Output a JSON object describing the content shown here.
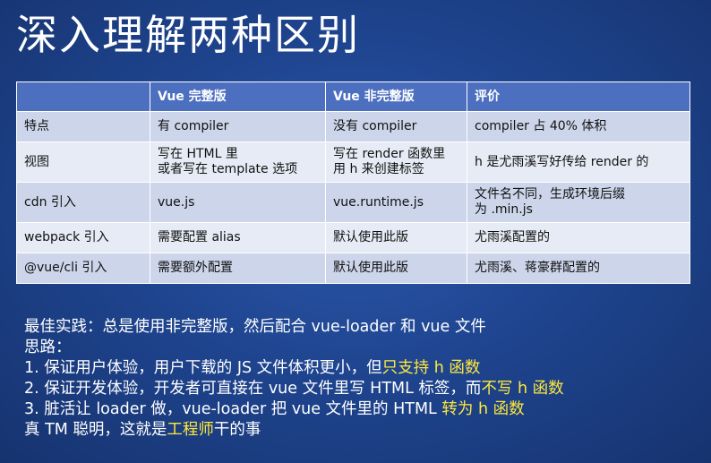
{
  "title": "深入理解两种区别",
  "table": {
    "headers": [
      "",
      "Vue 完整版",
      "Vue 非完整版",
      "评价"
    ],
    "rows": [
      [
        "特点",
        "有 compiler",
        "没有 compiler",
        "compiler 占 40% 体积"
      ],
      [
        "视图",
        "写在 HTML 里\n或者写在 template 选项",
        "写在 render 函数里\n用 h 来创建标签",
        "h 是尤雨溪写好传给 render 的"
      ],
      [
        "cdn 引入",
        "vue.js",
        "vue.runtime.js",
        "文件名不同，生成环境后缀\n为 .min.js"
      ],
      [
        "webpack 引入",
        "需要配置 alias",
        "默认使用此版",
        "尤雨溪配置的"
      ],
      [
        "@vue/cli 引入",
        "需要额外配置",
        "默认使用此版",
        "尤雨溪、蒋豪群配置的"
      ]
    ]
  },
  "notes": {
    "best_practice": "最佳实践：总是使用非完整版，然后配合 vue-loader 和 vue 文件",
    "thinking": "思路：",
    "item1_text": "1.  保证用户体验，用户下载的 JS 文件体积更小，但",
    "item1_hl": "只支持 h 函数",
    "item2_text": "2.  保证开发体验，开发者可直接在 vue 文件里写 HTML 标签，而",
    "item2_hl": "不写 h 函数",
    "item3_text": "3.  脏活让 loader 做，vue-loader 把 vue 文件里的 HTML ",
    "item3_hl": "转为 h 函数",
    "final_pre": "真 TM 聪明，这就是",
    "final_hl": "工程师",
    "final_post": "干的事"
  },
  "colors": {
    "highlight": "#ffe83c",
    "header_bg": "#4c6fc0",
    "row_odd": "#ccd5ea",
    "row_even": "#e6ebf5"
  }
}
